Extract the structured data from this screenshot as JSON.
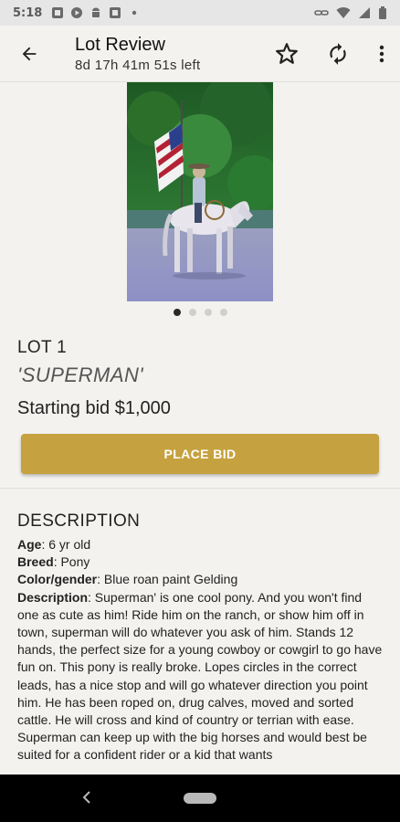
{
  "status_bar": {
    "time": "5:18",
    "icons_left": [
      "gallery-icon",
      "play-icon",
      "android-icon",
      "gallery-icon",
      "dot-icon"
    ],
    "icons_right": [
      "link-icon",
      "wifi-icon",
      "signal-icon",
      "battery-icon"
    ]
  },
  "app_bar": {
    "title": "Lot Review",
    "countdown": "8d 17h 41m 51s left",
    "actions": [
      "star-outline-icon",
      "refresh-icon",
      "more-vert-icon"
    ]
  },
  "gallery": {
    "image_count": 4,
    "active_index": 0
  },
  "lot": {
    "number_label": "LOT 1",
    "name": "'SUPERMAN'",
    "starting_bid": "Starting bid $1,000"
  },
  "bid_button": {
    "label": "PLACE BID"
  },
  "description": {
    "heading": "DESCRIPTION",
    "fields": [
      {
        "label": "Age",
        "value": ": 6 yr old"
      },
      {
        "label": "Breed",
        "value": ": Pony"
      },
      {
        "label": "Color/gender",
        "value": ": Blue roan paint Gelding"
      },
      {
        "label": "Description",
        "value": ": Superman' is one cool pony. And you won't find one as cute as him! Ride him on the ranch, or show him off in town, superman will do whatever you ask of him. Stands 12 hands, the perfect size for a young cowboy or cowgirl to go have fun on. This pony is really broke. Lopes circles in the correct leads, has a nice stop and will go whatever direction you point him. He has been roped on, drug calves, moved and sorted cattle. He will cross and kind of country or terrian with ease. Superman can keep up with the big horses and would best be suited for a confident rider or a kid that wants"
      }
    ]
  },
  "colors": {
    "accent": "#c6a13f",
    "background": "#f3f2ef",
    "status_bar": "#e6e6e6",
    "nav_bar": "#000000"
  }
}
